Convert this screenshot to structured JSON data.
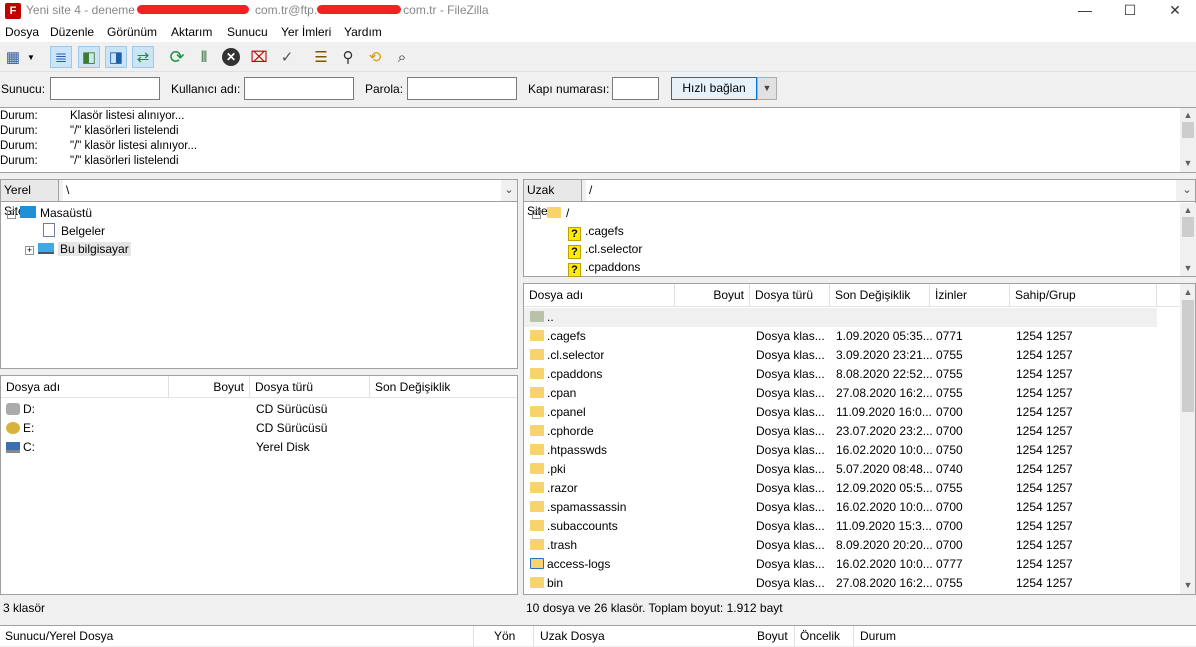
{
  "window": {
    "title_prefix": "Yeni site 4 - deneme",
    "title_mid": "com.tr@ftp.",
    "title_suffix": "com.tr - FileZilla",
    "minimize": "—",
    "maximize": "☐",
    "close": "✕"
  },
  "menu": [
    "Dosya",
    "Düzenle",
    "Görünüm",
    "Aktarım",
    "Sunucu",
    "Yer İmleri",
    "Yardım"
  ],
  "toolbar_icons": [
    "site-manager-icon",
    "dropdown-arrow-icon",
    "toggle-log-icon",
    "toggle-local-tree-icon",
    "toggle-remote-tree-icon",
    "toggle-queue-icon",
    "refresh-icon",
    "process-queue-icon",
    "cancel-icon",
    "disconnect-icon",
    "reconnect-icon",
    "directory-comparison-icon",
    "filter-icon",
    "sync-browsing-icon",
    "search-icon"
  ],
  "quickconnect": {
    "host_label": "Sunucu:",
    "user_label": "Kullanıcı adı:",
    "pass_label": "Parola:",
    "port_label": "Kapı numarası:",
    "connect_label": "Hızlı bağlan",
    "host_value": "",
    "user_value": "",
    "pass_value": "",
    "port_value": ""
  },
  "log": [
    {
      "key": "Durum:",
      "value": "Klasör listesi alınıyor..."
    },
    {
      "key": "Durum:",
      "value": "\"/\" klasörleri listelendi"
    },
    {
      "key": "Durum:",
      "value": "\"/\" klasör listesi alınıyor..."
    },
    {
      "key": "Durum:",
      "value": "\"/\" klasörleri listelendi"
    }
  ],
  "local": {
    "site_label": "Yerel Site:",
    "path": "\\",
    "tree": [
      {
        "label": "Masaüstü"
      },
      {
        "label": "Belgeler"
      },
      {
        "label": "Bu bilgisayar"
      }
    ],
    "columns": [
      "Dosya adı",
      "Boyut",
      "Dosya türü",
      "Son Değişiklik"
    ],
    "rows": [
      {
        "name": "D:",
        "size": "",
        "type": "CD Sürücüsü",
        "modified": "",
        "icon": "cd-drive-icon"
      },
      {
        "name": "E:",
        "size": "",
        "type": "CD Sürücüsü",
        "modified": "",
        "icon": "cd-drive-icon"
      },
      {
        "name": "C:",
        "size": "",
        "type": "Yerel Disk",
        "modified": "",
        "icon": "local-disk-icon"
      }
    ],
    "status": "3 klasör"
  },
  "remote": {
    "site_label": "Uzak Site:",
    "path": "/",
    "tree": [
      {
        "label": "/"
      },
      {
        "label": ".cagefs"
      },
      {
        "label": ".cl.selector"
      },
      {
        "label": ".cpaddons"
      }
    ],
    "columns": [
      "Dosya adı",
      "Boyut",
      "Dosya türü",
      "Son Değişiklik",
      "İzinler",
      "Sahip/Grup"
    ],
    "rows": [
      {
        "name": "..",
        "size": "",
        "type": "",
        "modified": "",
        "perms": "",
        "owner": ""
      },
      {
        "name": ".cagefs",
        "size": "",
        "type": "Dosya klas...",
        "modified": "1.09.2020 05:35...",
        "perms": "0771",
        "owner": "1254 1257"
      },
      {
        "name": ".cl.selector",
        "size": "",
        "type": "Dosya klas...",
        "modified": "3.09.2020 23:21...",
        "perms": "0755",
        "owner": "1254 1257"
      },
      {
        "name": ".cpaddons",
        "size": "",
        "type": "Dosya klas...",
        "modified": "8.08.2020 22:52...",
        "perms": "0755",
        "owner": "1254 1257"
      },
      {
        "name": ".cpan",
        "size": "",
        "type": "Dosya klas...",
        "modified": "27.08.2020 16:2...",
        "perms": "0755",
        "owner": "1254 1257"
      },
      {
        "name": ".cpanel",
        "size": "",
        "type": "Dosya klas...",
        "modified": "11.09.2020 16:0...",
        "perms": "0700",
        "owner": "1254 1257"
      },
      {
        "name": ".cphorde",
        "size": "",
        "type": "Dosya klas...",
        "modified": "23.07.2020 23:2...",
        "perms": "0700",
        "owner": "1254 1257"
      },
      {
        "name": ".htpasswds",
        "size": "",
        "type": "Dosya klas...",
        "modified": "16.02.2020 10:0...",
        "perms": "0750",
        "owner": "1254 1257"
      },
      {
        "name": ".pki",
        "size": "",
        "type": "Dosya klas...",
        "modified": "5.07.2020 08:48...",
        "perms": "0740",
        "owner": "1254 1257"
      },
      {
        "name": ".razor",
        "size": "",
        "type": "Dosya klas...",
        "modified": "12.09.2020 05:5...",
        "perms": "0755",
        "owner": "1254 1257"
      },
      {
        "name": ".spamassassin",
        "size": "",
        "type": "Dosya klas...",
        "modified": "16.02.2020 10:0...",
        "perms": "0700",
        "owner": "1254 1257"
      },
      {
        "name": ".subaccounts",
        "size": "",
        "type": "Dosya klas...",
        "modified": "11.09.2020 15:3...",
        "perms": "0700",
        "owner": "1254 1257"
      },
      {
        "name": ".trash",
        "size": "",
        "type": "Dosya klas...",
        "modified": "8.09.2020 20:20...",
        "perms": "0700",
        "owner": "1254 1257"
      },
      {
        "name": "access-logs",
        "size": "",
        "type": "Dosya klas...",
        "modified": "16.02.2020 10:0...",
        "perms": "0777",
        "owner": "1254 1257"
      },
      {
        "name": "bin",
        "size": "",
        "type": "Dosya klas...",
        "modified": "27.08.2020 16:2...",
        "perms": "0755",
        "owner": "1254 1257"
      }
    ],
    "status": "10 dosya ve 26 klasör. Toplam boyut: 1.912 bayt"
  },
  "queue": {
    "columns": [
      "Sunucu/Yerel Dosya",
      "Yön",
      "Uzak Dosya",
      "Boyut",
      "Öncelik",
      "Durum"
    ]
  },
  "colors": {
    "accent": "#0078d7",
    "folder": "#f6d36b",
    "redaction": "#f32222"
  }
}
